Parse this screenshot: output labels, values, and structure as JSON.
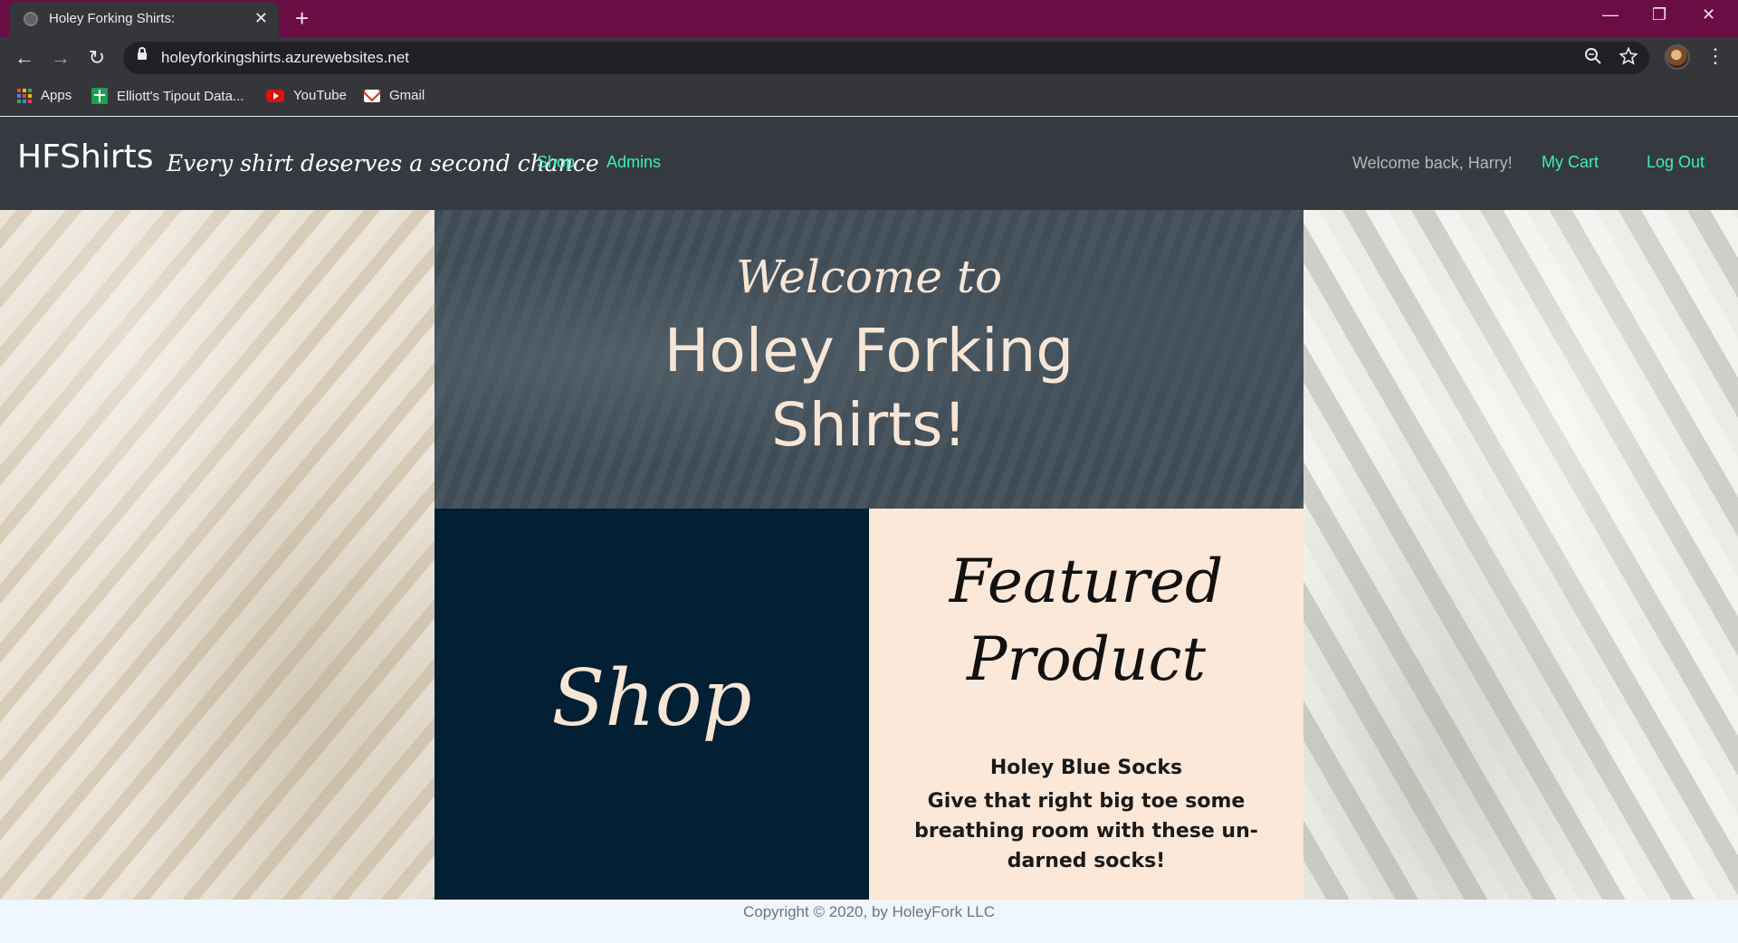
{
  "browser": {
    "tab_title": "Holey Forking Shirts:",
    "tab_close": "✕",
    "new_tab": "+",
    "url": "holeyforkingshirts.azurewebsites.net",
    "window_controls": {
      "minimize": "—",
      "restore": "❐",
      "close": "✕"
    },
    "nav": {
      "back": "←",
      "forward": "→",
      "reload": "↻"
    },
    "icons": {
      "zoom": "zoom-icon",
      "star": "star-icon",
      "menu": "⋮"
    },
    "bookmarks": [
      {
        "label": "Apps",
        "icon": "apps-grid-icon"
      },
      {
        "label": "Elliott's Tipout Data...",
        "icon": "sheets-icon"
      },
      {
        "label": "YouTube",
        "icon": "youtube-icon"
      },
      {
        "label": "Gmail",
        "icon": "gmail-icon"
      }
    ],
    "chrome_color": "#6b0d45"
  },
  "site_nav": {
    "brand": "HFShirts",
    "tagline": "Every shirt deserves a second chance",
    "links": [
      "Shop",
      "Admins"
    ],
    "welcome": "Welcome back, Harry!",
    "cart": "My Cart",
    "logout": "Log Out",
    "link_color": "#3df0b0"
  },
  "hero": {
    "welcome_script": "Welcome to",
    "title_line1": "Holey Forking",
    "title_line2": "Shirts!",
    "shop_label": "Shop",
    "featured": {
      "title_line1": "Featured",
      "title_line2": "Product",
      "product_name": "Holey Blue Socks",
      "product_desc": "Give that right big toe some breathing room with these un-darned socks!"
    }
  },
  "footer": {
    "copyright": "Copyright © 2020, by HoleyFork LLC"
  }
}
